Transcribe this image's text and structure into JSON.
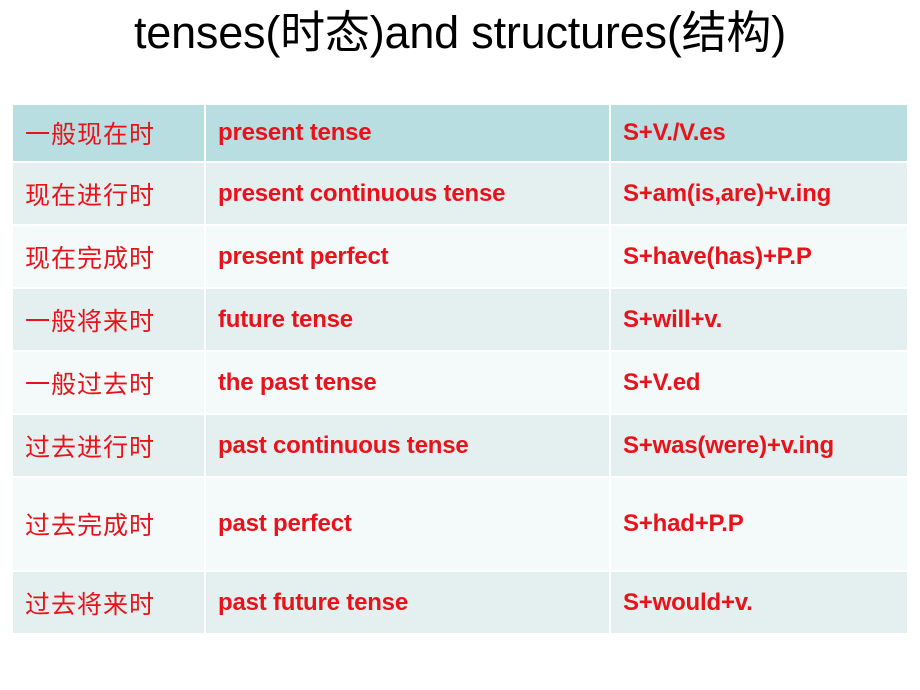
{
  "slide": {
    "title": "tenses(时态)and structures(结构)",
    "title_color": "#000000",
    "background_color": "#ffffff"
  },
  "colors": {
    "text_red": "#e8131a",
    "header_row_teal": "#b8dee2",
    "band_tinted": "#e4eff0",
    "band_light": "#f4f9fa",
    "grid_line": "#ffffff"
  },
  "table": {
    "columns": [
      {
        "key": "chinese",
        "label": ""
      },
      {
        "key": "english",
        "label": ""
      },
      {
        "key": "structure",
        "label": ""
      }
    ],
    "rows": [
      {
        "chinese": "一般现在时",
        "english": " present tense",
        "structure": "S+V./V.es"
      },
      {
        "chinese": "现在进行时",
        "english": " present continuous tense",
        "structure": "S+am(is,are)+v.ing"
      },
      {
        "chinese": "现在完成时",
        "english": "present perfect",
        "structure": "S+have(has)+P.P"
      },
      {
        "chinese": "一般将来时",
        "english": " future tense",
        "structure": "S+will+v."
      },
      {
        "chinese": "一般过去时",
        "english": "the past tense",
        "structure": "S+V.ed"
      },
      {
        "chinese": "过去进行时",
        "english": "past continuous tense",
        "structure": "S+was(were)+v.ing"
      },
      {
        "chinese": "过去完成时",
        "english": "past perfect",
        "structure": "S+had+P.P"
      },
      {
        "chinese": "过去将来时",
        "english": "past future tense",
        "structure": "S+would+v."
      }
    ]
  }
}
